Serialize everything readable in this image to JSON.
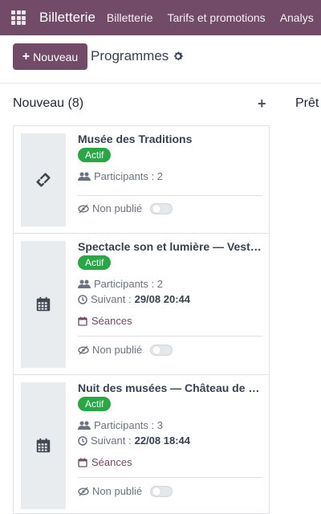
{
  "navbar": {
    "brand": "Billetterie",
    "menu": [
      "Billetterie",
      "Tarifs et promotions",
      "Analys"
    ]
  },
  "control": {
    "new_label": "Nouveau",
    "title": "Programmes"
  },
  "columns": [
    {
      "title": "Nouveau (8)"
    },
    {
      "title": "Prêt"
    }
  ],
  "cards": [
    {
      "title": "Musée des Traditions",
      "status": "Actif",
      "participants": "Participants : 2",
      "publish": "Non publié",
      "icon": "ticket-icon"
    },
    {
      "title": "Spectacle son et lumière — Vest…",
      "status": "Actif",
      "participants": "Participants : 2",
      "next_label": "Suivant :",
      "next_value": "29/08 20:44",
      "seances": "Séances",
      "publish": "Non publié",
      "icon": "calendar-icon"
    },
    {
      "title": "Nuit des musées — Château de …",
      "status": "Actif",
      "participants": "Participants : 3",
      "next_label": "Suivant :",
      "next_value": "22/08 18:44",
      "seances": "Séances",
      "publish": "Non publié",
      "icon": "calendar-icon"
    }
  ],
  "colors": {
    "brand": "#714b67",
    "active": "#28a745"
  }
}
